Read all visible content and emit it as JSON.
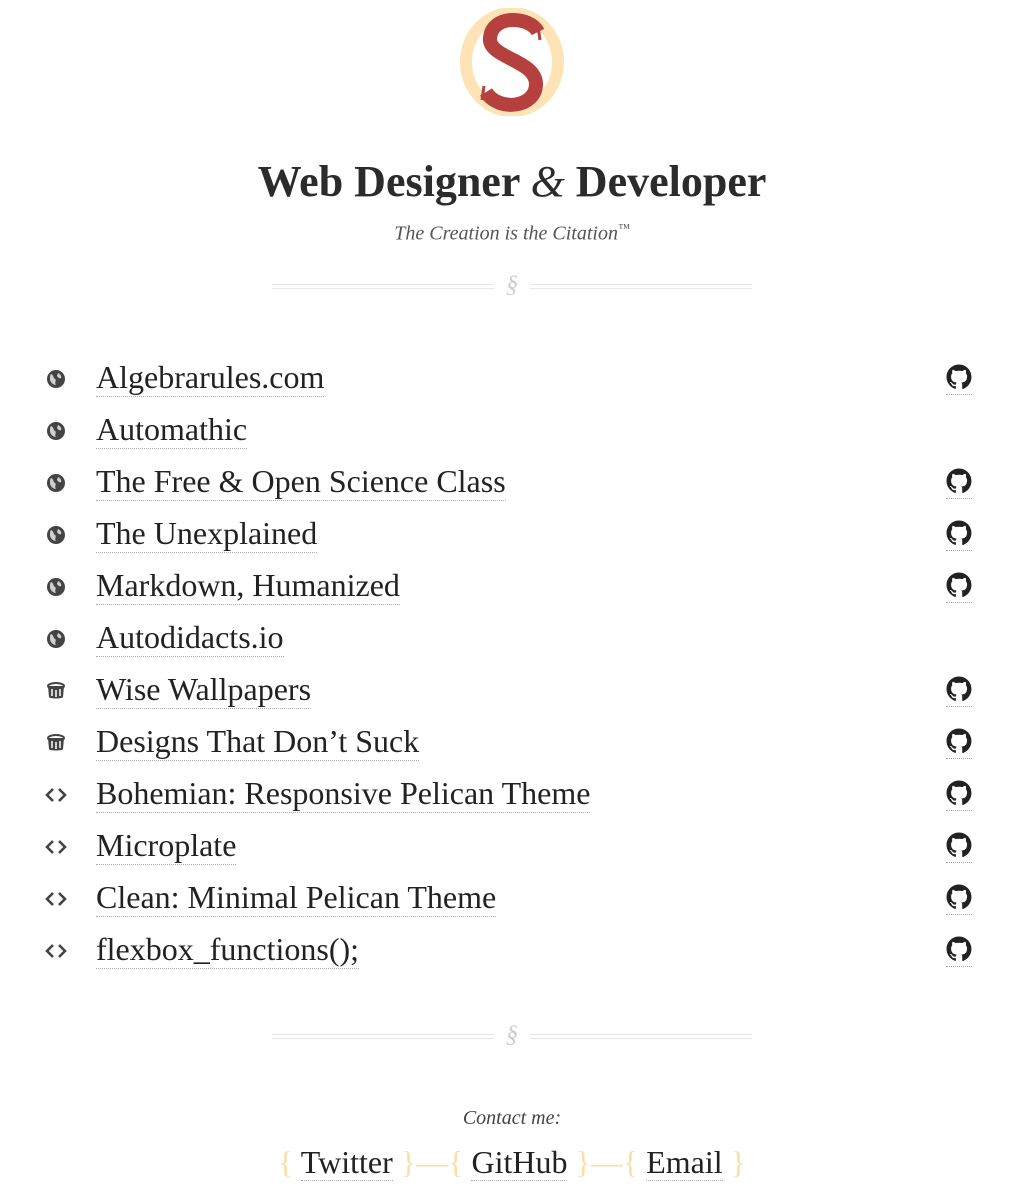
{
  "site": {
    "title_part1": "Web Designer",
    "title_amp": "&",
    "title_part2": "Developer",
    "tagline": "The Creation is the Citation",
    "tagline_mark": "™",
    "divider_mark": "§"
  },
  "projects": [
    {
      "name": "Algebrarules.com",
      "type_icon": "globe-icon",
      "github": true
    },
    {
      "name": "Automathic",
      "type_icon": "globe-icon",
      "github": false
    },
    {
      "name": "The Free & Open Science Class",
      "type_icon": "globe-icon",
      "github": true
    },
    {
      "name": "The Unexplained",
      "type_icon": "globe-icon",
      "github": true
    },
    {
      "name": "Markdown, Humanized",
      "type_icon": "globe-icon",
      "github": true
    },
    {
      "name": "Autodidacts.io",
      "type_icon": "globe-icon",
      "github": false
    },
    {
      "name": "Wise Wallpapers",
      "type_icon": "paint-bucket-icon",
      "github": true
    },
    {
      "name": "Designs That Don’t Suck",
      "type_icon": "paint-bucket-icon",
      "github": true
    },
    {
      "name": "Bohemian: Responsive Pelican Theme",
      "type_icon": "code-icon",
      "github": true
    },
    {
      "name": "Microplate",
      "type_icon": "code-icon",
      "github": true
    },
    {
      "name": "Clean: Minimal Pelican Theme",
      "type_icon": "code-icon",
      "github": true
    },
    {
      "name": "flexbox_functions();",
      "type_icon": "code-icon",
      "github": true
    }
  ],
  "contact": {
    "label": "Contact me:",
    "links": [
      "Twitter",
      "GitHub",
      "Email"
    ],
    "bracket_open": "{",
    "bracket_close": "}",
    "separator": "—"
  },
  "colors": {
    "logo_ring": "#fde3b5",
    "logo_letter": "#b5403e",
    "accent_bracket": "#fcdfa8",
    "text": "#222222"
  }
}
